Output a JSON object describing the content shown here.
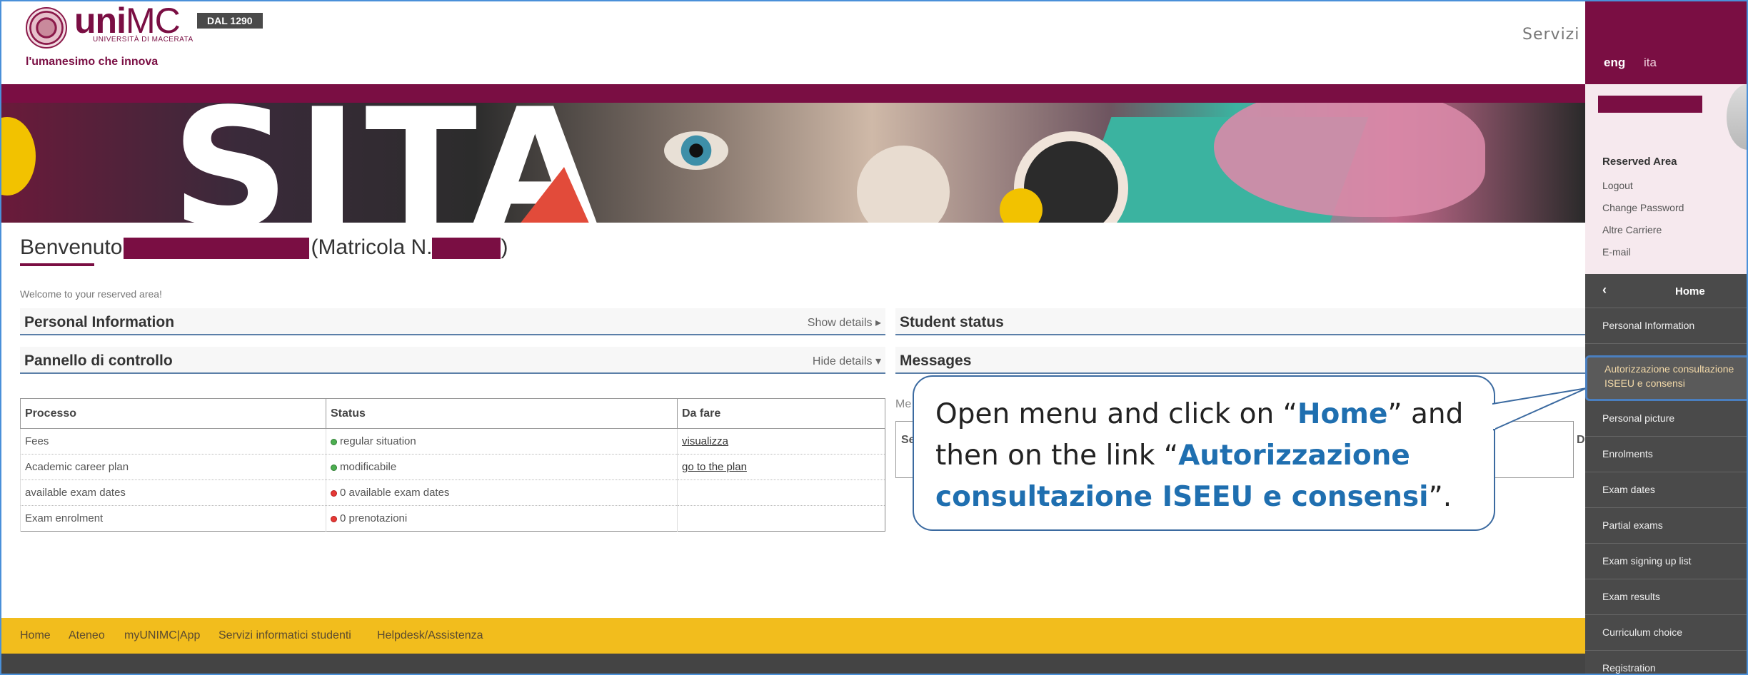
{
  "header": {
    "logo_wordmark_bold": "uni",
    "logo_wordmark_rest": "MC",
    "logo_subtitle": "UNIVERSITÀ DI MACERATA",
    "motto": "l'umanesimo che innova",
    "badge": "DAL 1290",
    "servizi": "Servizi o"
  },
  "welcome": {
    "prefix": "Benvenuto",
    "matricola_open": "(Matricola N.",
    "matricola_close": ")",
    "subtitle": "Welcome to your reserved area!"
  },
  "sections": {
    "personal_info": {
      "title": "Personal Information",
      "toggle": "Show details"
    },
    "pannello": {
      "title": "Pannello di controllo",
      "toggle": "Hide details"
    },
    "student_status": {
      "title": "Student status"
    },
    "messages": {
      "title": "Messages"
    }
  },
  "process_table": {
    "headers": [
      "Processo",
      "Status",
      "Da fare"
    ],
    "rows": [
      {
        "processo": "Fees",
        "status": "regular situation",
        "status_color": "green",
        "action": "visualizza"
      },
      {
        "processo": "Academic career plan",
        "status": "modificabile",
        "status_color": "green",
        "action": "go to the plan"
      },
      {
        "processo": "available exam dates",
        "status": "0 available exam dates",
        "status_color": "red",
        "action": ""
      },
      {
        "processo": "Exam enrolment",
        "status": "0 prenotazioni",
        "status_color": "red",
        "action": ""
      }
    ]
  },
  "messages_fragments": {
    "label": "Me",
    "col": "Se",
    "col_right": "D"
  },
  "callout": {
    "part1": "Open menu and click on “",
    "home": "Home",
    "part2": "” and then on the link “",
    "link": "Autorizzazione consultazione ISEEU e consensi",
    "part3": "”."
  },
  "footer": {
    "links": [
      "Home",
      "Ateneo",
      "myUNIMC|App",
      "Servizi informatici studenti",
      "Helpdesk/Assistenza"
    ]
  },
  "side_panel": {
    "lang_eng": "eng",
    "lang_ita": "ita",
    "reserved_title": "Reserved Area",
    "reserved_links": [
      "Logout",
      "Change Password",
      "Altre Carriere",
      "E-mail"
    ],
    "menu_back": "‹",
    "menu_home": "Home",
    "menu_items": [
      "Personal Information",
      "Autorizzazione consultazione ISEEU e consensi",
      "Personal picture",
      "Enrolments",
      "Exam dates",
      "Partial exams",
      "Exam signing up list",
      "Exam results",
      "Curriculum choice",
      "Registration"
    ]
  },
  "colors": {
    "brand_maroon": "#7a0e43",
    "footer_yellow": "#f2bd1d",
    "callout_highlight": "#1f6fb0",
    "menu_dark": "#4a4a4a"
  }
}
